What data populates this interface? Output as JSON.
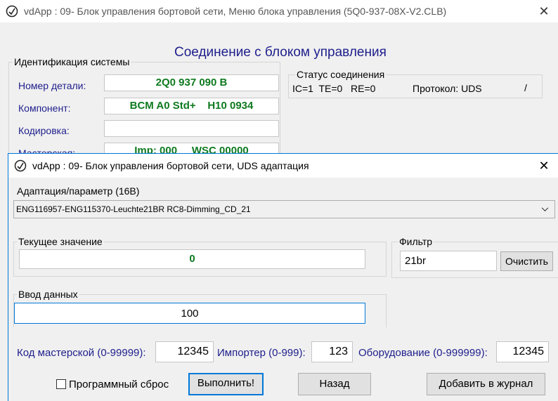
{
  "main_window": {
    "title": "vdApp : 09- Блок управления бортовой сети,  Меню блока управления (5Q0-937-08X-V2.CLB)",
    "heading": "Соединение с блоком управления",
    "ident_group": "Идентификация системы",
    "part_label": "Номер детали:",
    "part_value": "2Q0 937 090 B",
    "component_label": "Компонент:",
    "component_value": "BCM A0 Std+    H10 0934",
    "coding_label": "Кодировка:",
    "coding_value": "",
    "workshop_label": "Мастерская:",
    "workshop_value": "Imp: 000     WSC 00000",
    "status_group": "Статус соединения",
    "status_text": "IC=1  TE=0   RE=0",
    "protocol_text": "Протокол: UDS",
    "spinner": "/"
  },
  "dialog": {
    "title": "vdApp : 09- Блок управления бортовой сети,  UDS адаптация",
    "adapt_label": "Адаптация/параметр (16B)",
    "adapt_selected": "ENG116957-ENG115370-Leuchte21BR RC8-Dimming_CD_21",
    "current_group": "Текущее значение",
    "current_value": "0",
    "filter_group": "Фильтр",
    "filter_value": "21br",
    "clear_button": "Очистить",
    "input_group": "Ввод данных",
    "input_value": "100",
    "workshop_code_label": "Код мастерской (0-99999):",
    "workshop_code_value": "12345",
    "importer_label": "Импортер (0-999):",
    "importer_value": "123",
    "equipment_label": "Оборудование (0-999999):",
    "equipment_value": "12345",
    "soft_reset_label": "Программный сброс",
    "execute_button": "Выполнить!",
    "back_button": "Назад",
    "log_button": "Добавить в журнал"
  },
  "icons": {
    "app": "app-icon",
    "close": "close-icon",
    "dropdown": "chevron-down-icon"
  },
  "colors": {
    "accent": "#0078d7",
    "value_green": "#0f7a1f",
    "label_navy": "#1e1e8c"
  }
}
